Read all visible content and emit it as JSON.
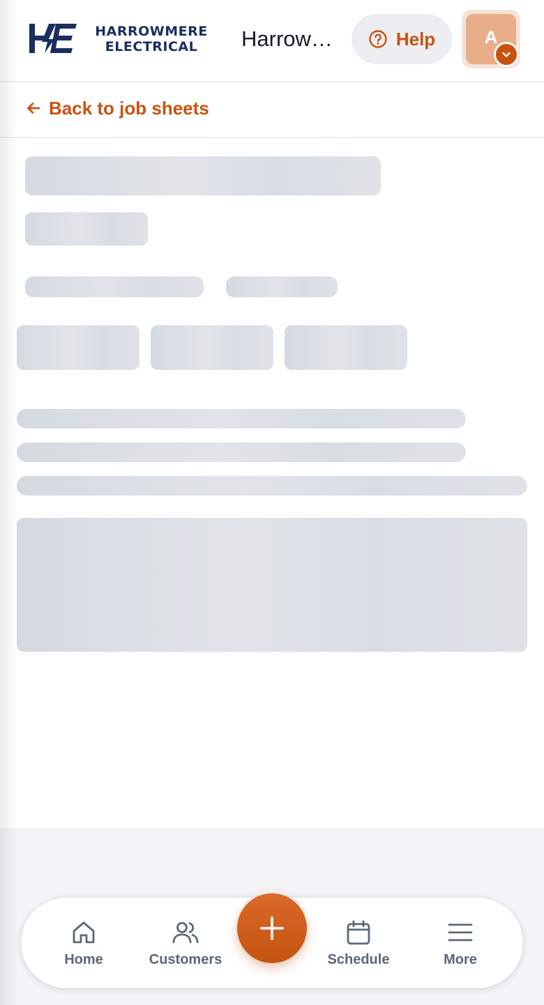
{
  "header": {
    "logo_line1": "HARROWMERE",
    "logo_line2": "ELECTRICAL",
    "company_name": "Harrowmere Electrical",
    "help_label": "Help",
    "avatar_initial": "A"
  },
  "nav": {
    "back_label": "Back to job sheets"
  },
  "bottom_nav": {
    "items": [
      {
        "label": "Home",
        "icon": "home-icon"
      },
      {
        "label": "Customers",
        "icon": "users-icon"
      },
      {
        "label": "Schedule",
        "icon": "calendar-icon"
      },
      {
        "label": "More",
        "icon": "menu-icon"
      }
    ],
    "fab_icon": "plus-icon"
  },
  "colors": {
    "accent": "#c9520e",
    "brand_navy": "#1b2f5e",
    "skeleton": "#dbe0e6",
    "nav_text": "#5c6878"
  }
}
